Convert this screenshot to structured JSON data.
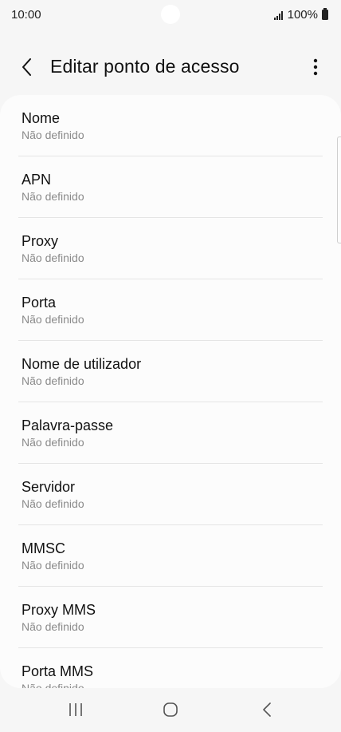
{
  "status_bar": {
    "time": "10:00",
    "battery": "100%"
  },
  "header": {
    "title": "Editar ponto de acesso",
    "back_icon": "chevron-left-icon",
    "more_icon": "more-vertical-icon"
  },
  "items": [
    {
      "title": "Nome",
      "subtitle": "Não definido"
    },
    {
      "title": "APN",
      "subtitle": "Não definido"
    },
    {
      "title": "Proxy",
      "subtitle": "Não definido"
    },
    {
      "title": "Porta",
      "subtitle": "Não definido"
    },
    {
      "title": "Nome de utilizador",
      "subtitle": "Não definido"
    },
    {
      "title": "Palavra-passe",
      "subtitle": "Não definido"
    },
    {
      "title": "Servidor",
      "subtitle": "Não definido"
    },
    {
      "title": "MMSC",
      "subtitle": "Não definido"
    },
    {
      "title": "Proxy MMS",
      "subtitle": "Não definido"
    },
    {
      "title": "Porta MMS",
      "subtitle": "Não definido"
    }
  ],
  "nav_bar": {
    "recents_icon": "recents-icon",
    "home_icon": "home-icon",
    "back_icon": "back-icon"
  },
  "colors": {
    "background": "#f6f6f6",
    "card": "#fcfcfc",
    "subtitle": "#8a8a8a",
    "divider": "#e5e5e5"
  }
}
